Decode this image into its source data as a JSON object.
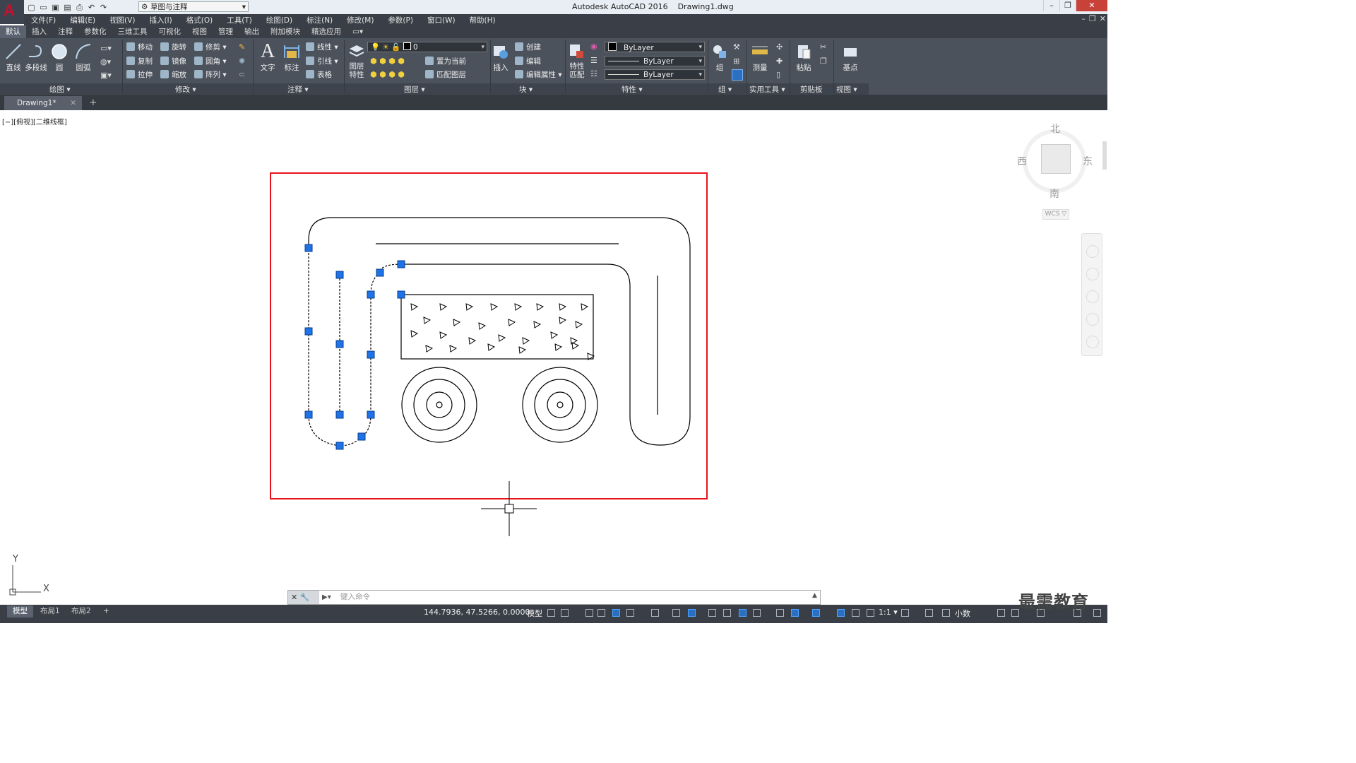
{
  "window": {
    "title": "Autodesk AutoCAD 2016    Drawing1.dwg",
    "workspace": "草图与注释"
  },
  "menu": [
    "文件(F)",
    "编辑(E)",
    "视图(V)",
    "插入(I)",
    "格式(O)",
    "工具(T)",
    "绘图(D)",
    "标注(N)",
    "修改(M)",
    "参数(P)",
    "窗口(W)",
    "帮助(H)"
  ],
  "ribbon_tabs": [
    "默认",
    "插入",
    "注释",
    "参数化",
    "三维工具",
    "可视化",
    "视图",
    "管理",
    "输出",
    "附加模块",
    "精选应用"
  ],
  "ribbon": {
    "draw": {
      "line": "直线",
      "polyline": "多段线",
      "circle": "圆",
      "arc": "圆弧",
      "panel": "绘图 ▾"
    },
    "modify": {
      "move": "移动",
      "rotate": "旋转",
      "trim": "修剪",
      "copy": "复制",
      "mirror": "镜像",
      "fillet": "圆角",
      "stretch": "拉伸",
      "scale": "缩放",
      "array": "阵列",
      "panel": "修改 ▾"
    },
    "annotation": {
      "text": "文字",
      "dimension": "标注",
      "linear": "线性",
      "leader": "引线",
      "table": "表格",
      "panel": "注释 ▾"
    },
    "layers": {
      "props": "图层\n特性",
      "current_layer": "0",
      "set_current": "置为当前",
      "match": "匹配图层",
      "panel": "图层 ▾"
    },
    "block": {
      "insert": "插入",
      "create": "创建",
      "edit": "编辑",
      "edit_attr": "编辑属性",
      "panel": "块 ▾"
    },
    "properties": {
      "match": "特性\n匹配",
      "color": "ByLayer",
      "linetype": "ByLayer",
      "lineweight": "ByLayer",
      "panel": "特性 ▾"
    },
    "groups": {
      "group": "组",
      "panel": "组 ▾"
    },
    "utilities": {
      "measure": "测量",
      "panel": "实用工具 ▾"
    },
    "clipboard": {
      "paste": "粘贴",
      "panel": "剪贴板"
    },
    "view": {
      "base": "基点",
      "panel": "视图 ▾"
    }
  },
  "doc_tab": "Drawing1*",
  "view_label": "[−][俯视][二维线框]",
  "viewcube": {
    "north": "北",
    "south": "南",
    "east": "东",
    "west": "西",
    "wcs": "WCS ▽"
  },
  "ucs": {
    "x": "X",
    "y": "Y"
  },
  "command": {
    "placeholder": "键入命令"
  },
  "layout_tabs": [
    "模型",
    "布局1",
    "布局2"
  ],
  "status": {
    "coords": "144.7936, 47.5266, 0.0000",
    "mode": "模型",
    "scale": "1:1 ▾",
    "units": "小数"
  },
  "watermark": "最需教育",
  "colors": {
    "accent": "#e8121c",
    "grip": "#1e73e8",
    "ribbon": "#4b525c",
    "dark": "#3a3f47"
  }
}
